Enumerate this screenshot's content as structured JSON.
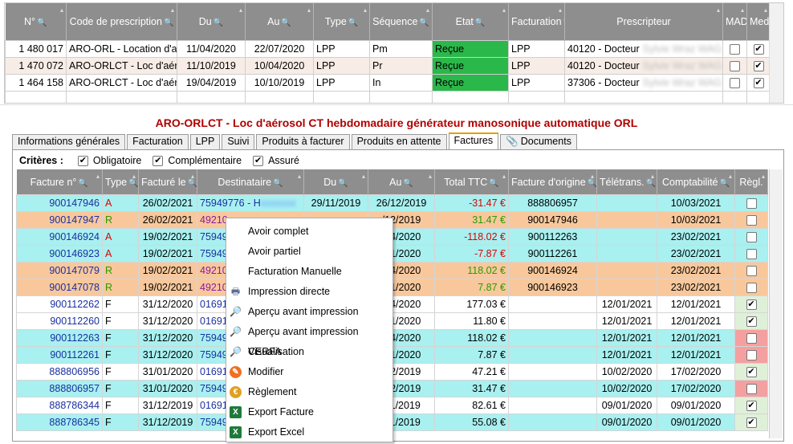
{
  "top_grid": {
    "columns": [
      "N°",
      "Code de prescription",
      "Du",
      "Au",
      "Type",
      "Séquence",
      "Etat",
      "Facturation",
      "Prescripteur",
      "MAD",
      "Med"
    ],
    "rows": [
      {
        "num": "1 480 017",
        "code": "ARO-ORL - Location d'a",
        "du": "11/04/2020",
        "au": "22/07/2020",
        "type": "LPP",
        "seq": "Pm",
        "etat": "Reçue",
        "fact": "LPP",
        "presc": "40120 - Docteur",
        "presc_blur": "Sylvie Wraz WAG",
        "mad": false,
        "med": true
      },
      {
        "num": "1 470 072",
        "code": "ARO-ORLCT - Loc d'aér",
        "du": "11/10/2019",
        "au": "10/04/2020",
        "type": "LPP",
        "seq": "Pr",
        "etat": "Reçue",
        "fact": "LPP",
        "presc": "40120 - Docteur",
        "presc_blur": "Sylvie Wraz WAG",
        "mad": false,
        "med": true
      },
      {
        "num": "1 464 158",
        "code": "ARO-ORLCT - Loc d'aér",
        "du": "19/04/2019",
        "au": "10/10/2019",
        "type": "LPP",
        "seq": "In",
        "etat": "Reçue",
        "fact": "LPP",
        "presc": "37306 - Docteur",
        "presc_blur": "Sylvie Wraz WAG",
        "mad": false,
        "med": true
      }
    ]
  },
  "title": "ARO-ORLCT - Loc d'aérosol  CT hebdomadaire générateur manosonique automatique ORL",
  "tabs": [
    "Informations générales",
    "Facturation",
    "LPP",
    "Suivi",
    "Produits à facturer",
    "Produits en attente",
    "Factures",
    "Documents"
  ],
  "criteria": {
    "label": "Critères :",
    "items": [
      {
        "label": "Obligatoire",
        "checked": true
      },
      {
        "label": "Complémentaire",
        "checked": true
      },
      {
        "label": "Assuré",
        "checked": true
      }
    ]
  },
  "invoice_grid": {
    "columns": [
      "Facture n°",
      "Type",
      "Facturé le",
      "Destinataire",
      "Du",
      "Au",
      "Total TTC",
      "Facture d'origine",
      "Télétrans.",
      "Comptabilité",
      "Règl."
    ],
    "rows": [
      {
        "num": "900147946",
        "type": "A",
        "date": "26/02/2021",
        "dest": "75949776 - H",
        "dest2": "GM(",
        "du": "29/11/2019",
        "au": "26/12/2019",
        "total": "-31.47 €",
        "orig": "888806957",
        "tele": "",
        "compta": "10/03/2021",
        "regl": false,
        "bg": "#a9f0f0",
        "tcol": "red",
        "ttot": "red"
      },
      {
        "num": "900147947",
        "type": "R",
        "date": "26/02/2021",
        "dest": "49210",
        "dest2": "",
        "du": "",
        "au": "/12/2019",
        "total": "31.47 €",
        "orig": "900147946",
        "tele": "",
        "compta": "10/03/2021",
        "regl": false,
        "bg": "#f8c89c",
        "tcol": "green",
        "ttot": "green"
      },
      {
        "num": "900146924",
        "type": "A",
        "date": "19/02/2021",
        "dest": "75949",
        "dest2": "",
        "du": "",
        "au": "/04/2020",
        "total": "-118.02 €",
        "orig": "900112263",
        "tele": "",
        "compta": "23/02/2021",
        "regl": false,
        "bg": "#a9f0f0",
        "tcol": "red",
        "ttot": "red"
      },
      {
        "num": "900146923",
        "type": "A",
        "date": "19/02/2021",
        "dest": "75949",
        "dest2": "",
        "du": "",
        "au": "/01/2020",
        "total": "-7.87 €",
        "orig": "900112261",
        "tele": "",
        "compta": "23/02/2021",
        "regl": false,
        "bg": "#a9f0f0",
        "tcol": "red",
        "ttot": "red"
      },
      {
        "num": "900147079",
        "type": "R",
        "date": "19/02/2021",
        "dest": "49210",
        "dest2": "",
        "du": "",
        "au": "/04/2020",
        "total": "118.02 €",
        "orig": "900146924",
        "tele": "",
        "compta": "23/02/2021",
        "regl": false,
        "bg": "#f8c89c",
        "tcol": "green",
        "ttot": "green"
      },
      {
        "num": "900147078",
        "type": "R",
        "date": "19/02/2021",
        "dest": "49210",
        "dest2": "",
        "du": "",
        "au": "/01/2020",
        "total": "7.87 €",
        "orig": "900146923",
        "tele": "",
        "compta": "23/02/2021",
        "regl": false,
        "bg": "#f8c89c",
        "tcol": "green",
        "ttot": "green"
      },
      {
        "num": "900112262",
        "type": "F",
        "date": "31/12/2020",
        "dest": "01691",
        "dest2": "",
        "du": "",
        "au": "/04/2020",
        "total": "177.03 €",
        "orig": "",
        "tele": "12/01/2021",
        "compta": "12/01/2021",
        "regl": true,
        "bg": "#ffffff",
        "tcol": "",
        "ttot": ""
      },
      {
        "num": "900112260",
        "type": "F",
        "date": "31/12/2020",
        "dest": "01691",
        "dest2": "",
        "du": "",
        "au": "/01/2020",
        "total": "11.80 €",
        "orig": "",
        "tele": "12/01/2021",
        "compta": "12/01/2021",
        "regl": true,
        "bg": "#ffffff",
        "tcol": "",
        "ttot": ""
      },
      {
        "num": "900112263",
        "type": "F",
        "date": "31/12/2020",
        "dest": "75949",
        "dest2": "",
        "du": "",
        "au": "/04/2020",
        "total": "118.02 €",
        "orig": "",
        "tele": "12/01/2021",
        "compta": "12/01/2021",
        "regl": false,
        "bg": "#a9f0f0",
        "tcol": "",
        "ttot": "",
        "reglbg": "#f4a0a0"
      },
      {
        "num": "900112261",
        "type": "F",
        "date": "31/12/2020",
        "dest": "75949",
        "dest2": "",
        "du": "",
        "au": "/01/2020",
        "total": "7.87 €",
        "orig": "",
        "tele": "12/01/2021",
        "compta": "12/01/2021",
        "regl": false,
        "bg": "#a9f0f0",
        "tcol": "",
        "ttot": "",
        "reglbg": "#f4a0a0"
      },
      {
        "num": "888806956",
        "type": "F",
        "date": "31/01/2020",
        "dest": "01691",
        "dest2": "",
        "du": "",
        "au": "/12/2019",
        "total": "47.21 €",
        "orig": "",
        "tele": "10/02/2020",
        "compta": "17/02/2020",
        "regl": true,
        "bg": "#ffffff",
        "tcol": "",
        "ttot": ""
      },
      {
        "num": "888806957",
        "type": "F",
        "date": "31/01/2020",
        "dest": "75949",
        "dest2": "",
        "du": "",
        "au": "/12/2019",
        "total": "31.47 €",
        "orig": "",
        "tele": "10/02/2020",
        "compta": "17/02/2020",
        "regl": false,
        "bg": "#a9f0f0",
        "tcol": "",
        "ttot": "",
        "reglbg": "#f4a0a0"
      },
      {
        "num": "888786344",
        "type": "F",
        "date": "31/12/2019",
        "dest": "01691",
        "dest2": "",
        "du": "",
        "au": "/11/2019",
        "total": "82.61 €",
        "orig": "",
        "tele": "09/01/2020",
        "compta": "09/01/2020",
        "regl": true,
        "bg": "#ffffff",
        "tcol": "",
        "ttot": ""
      },
      {
        "num": "888786345",
        "type": "F",
        "date": "31/12/2019",
        "dest": "75949",
        "dest2": "",
        "du": "",
        "au": "/11/2019",
        "total": "55.08 €",
        "orig": "",
        "tele": "09/01/2020",
        "compta": "09/01/2020",
        "regl": true,
        "bg": "#a9f0f0",
        "tcol": "",
        "ttot": ""
      }
    ]
  },
  "context_menu": [
    {
      "label": "Avoir complet",
      "icon": ""
    },
    {
      "label": "Avoir partiel",
      "icon": ""
    },
    {
      "label": "Facturation Manuelle",
      "icon": ""
    },
    {
      "label": "Impression directe",
      "icon": "printer-icon"
    },
    {
      "label": "Aperçu avant impression",
      "icon": "magnifier-icon"
    },
    {
      "label": "Aperçu avant impression CERFA",
      "icon": "magnifier-icon"
    },
    {
      "label": "Visualisation",
      "icon": "magnifier-icon"
    },
    {
      "label": "Modifier",
      "icon": "edit-icon"
    },
    {
      "label": "Règlement",
      "icon": "coins-icon"
    },
    {
      "label": "Export Facture",
      "icon": "excel-icon"
    },
    {
      "label": "Export Excel",
      "icon": "excel-icon"
    }
  ]
}
